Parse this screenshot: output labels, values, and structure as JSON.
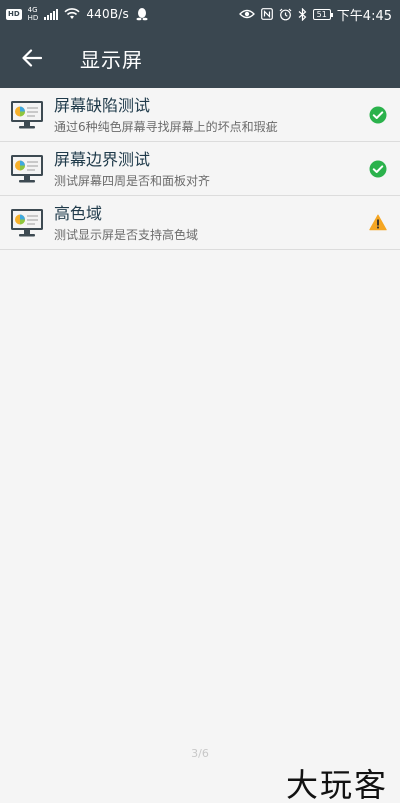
{
  "status_bar": {
    "hd_badge": "HD",
    "network_type_top": "4G",
    "network_type_bottom": "HD",
    "speed": "440B/s",
    "battery": "51",
    "time": "下午4:45"
  },
  "app_bar": {
    "title": "显示屏",
    "back_icon": "arrow-left-icon"
  },
  "items": [
    {
      "title": "屏幕缺陷测试",
      "subtitle": "通过6种纯色屏幕寻找屏幕上的坏点和瑕疵",
      "status": "pass",
      "status_icon": "check-circle-icon"
    },
    {
      "title": "屏幕边界测试",
      "subtitle": "测试屏幕四周是否和面板对齐",
      "status": "pass",
      "status_icon": "check-circle-icon"
    },
    {
      "title": "高色域",
      "subtitle": "测试显示屏是否支持高色域",
      "status": "warning",
      "status_icon": "warning-triangle-icon"
    }
  ],
  "colors": {
    "header_bg": "#3a4750",
    "pass_green": "#2bb24c",
    "warning_orange": "#f5a623",
    "title_text": "#1f3a4a",
    "subtitle_text": "#6b6b6b"
  },
  "footer": {
    "page_indicator": "3/6",
    "watermark": "大玩客"
  }
}
